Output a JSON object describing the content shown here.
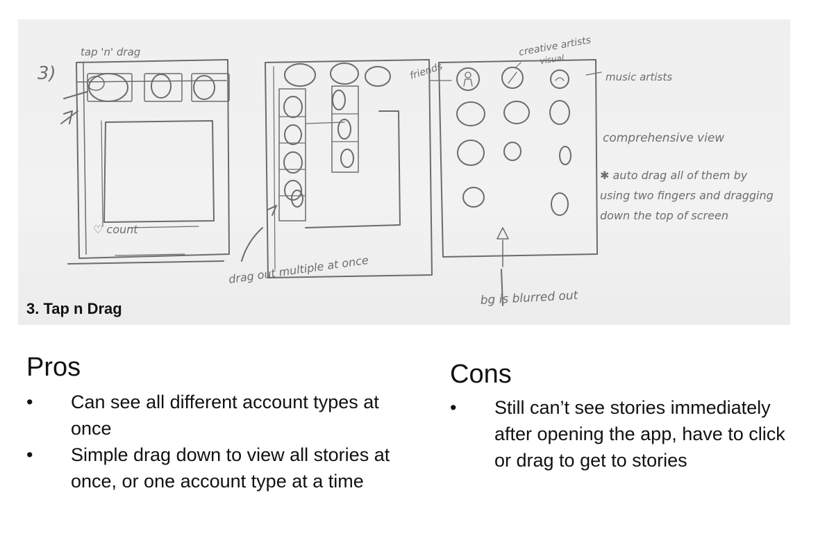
{
  "sketch": {
    "caption": "3. Tap n Drag",
    "notes": {
      "step_number": "3)",
      "tap_n_drag": "tap 'n' drag",
      "heart_count": "♡ count",
      "friends": "friends",
      "creative_artists": "creative artists",
      "visual": "visual",
      "music_artists": "music artists",
      "comprehensive_view": "comprehensive view",
      "auto_drag": "✱ auto drag all of them by using two fingers and dragging down the top of screen",
      "drag_multiple": "drag out multiple at once",
      "bg_blurred": "bg is blurred out"
    }
  },
  "pros": {
    "title": "Pros",
    "bullet_symbol": "•",
    "items": [
      "Can see all different account types at once",
      "Simple drag down to view all stories at once, or one account type at a time"
    ]
  },
  "cons": {
    "title": "Cons",
    "bullet_symbol": "•",
    "items": [
      "Still can’t see stories immediately after opening the app, have to click or drag to get to stories"
    ]
  }
}
